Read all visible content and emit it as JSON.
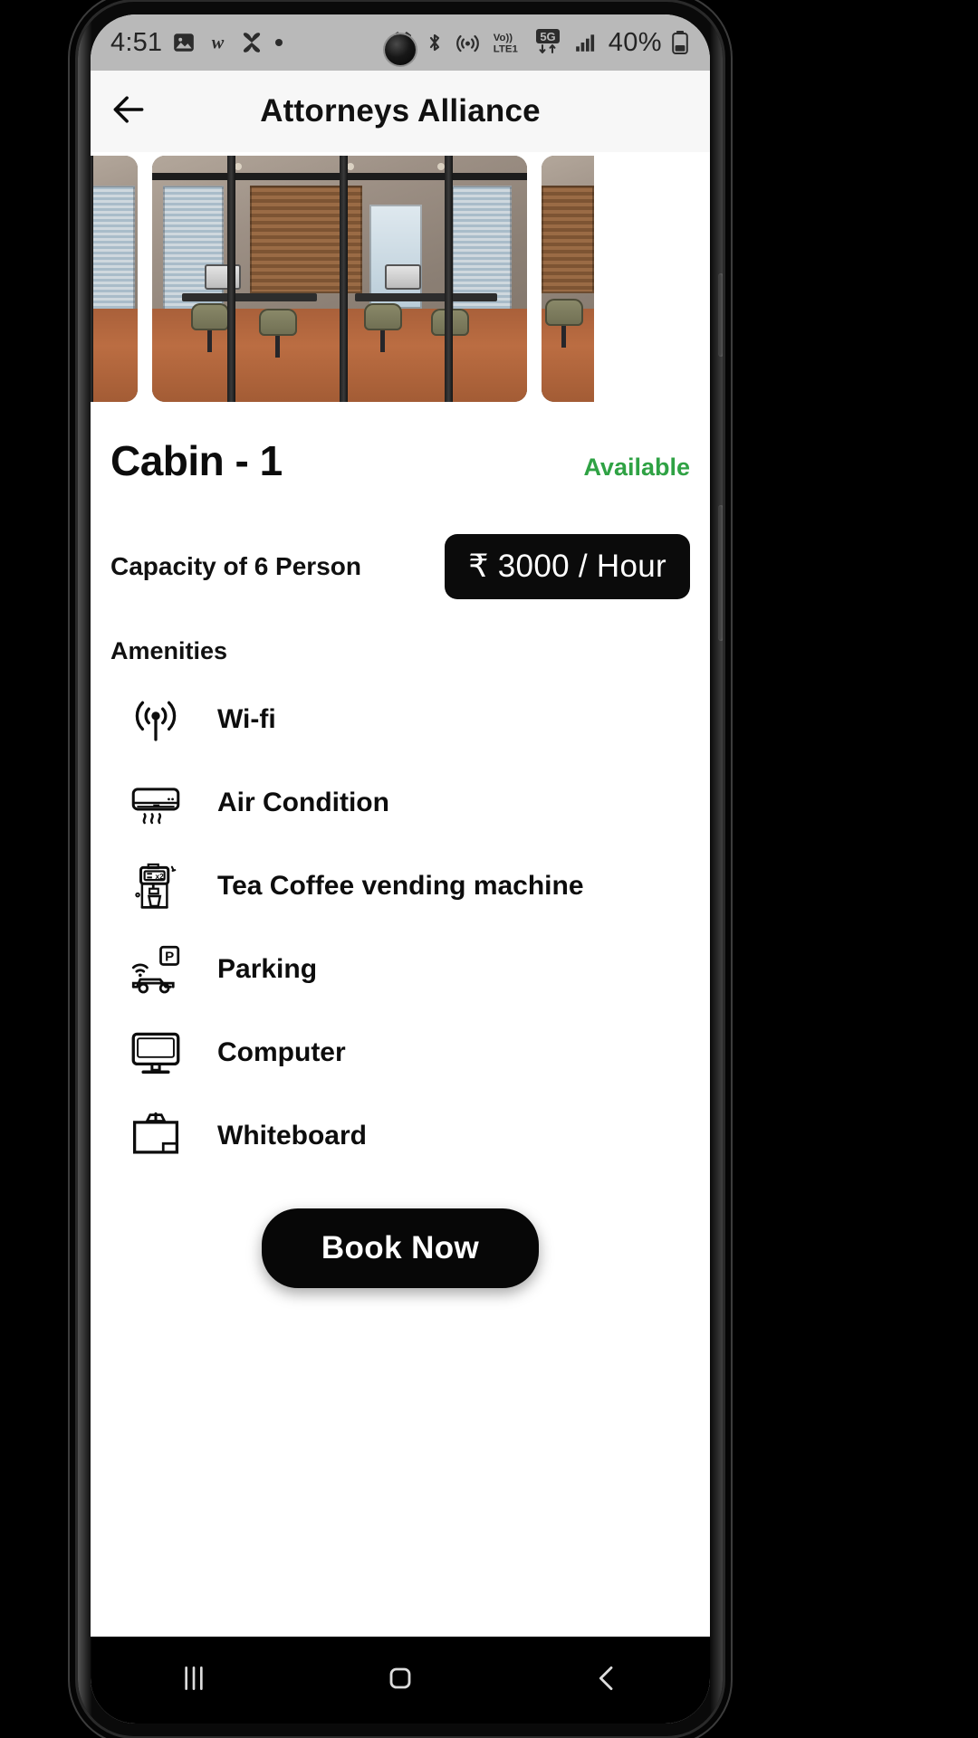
{
  "status_bar": {
    "time": "4:51",
    "left_icons": [
      "photo-icon",
      "w-app-icon",
      "clover-icon",
      "dot-icon"
    ],
    "right_icons": [
      "alarm-icon",
      "bluetooth-icon",
      "hotspot-icon",
      "volte-icon",
      "5g-icon",
      "signal-icon"
    ],
    "volte_label": "Vo))",
    "volte_sub": "LTE1",
    "network_label": "5G",
    "battery_percent": "40%"
  },
  "app_bar": {
    "back_icon": "arrow-left-icon",
    "title": "Attorneys Alliance"
  },
  "carousel": {
    "slide_count": 3,
    "active_index": 1,
    "alt": "Meeting room with glass partitions, wooden blinds, conference table and chairs"
  },
  "detail": {
    "room_title": "Cabin - 1",
    "availability": "Available",
    "availability_color": "#2fa244",
    "capacity": "Capacity of 6 Person",
    "price": "₹ 3000 / Hour",
    "price_bg": "#0b0b0b",
    "amenities_heading": "Amenities",
    "amenities": [
      {
        "label": "Wi-fi",
        "icon": "wifi-icon"
      },
      {
        "label": "Air Condition",
        "icon": "air-conditioner-icon"
      },
      {
        "label": "Tea Coffee vending machine",
        "icon": "coffee-machine-icon"
      },
      {
        "label": "Parking",
        "icon": "parking-car-icon"
      },
      {
        "label": "Computer",
        "icon": "monitor-icon"
      },
      {
        "label": "Whiteboard",
        "icon": "whiteboard-icon"
      }
    ],
    "book_button": "Book Now"
  },
  "nav_bar": {
    "recents_icon": "recents-icon",
    "home_icon": "home-icon",
    "back_icon": "nav-back-icon"
  }
}
